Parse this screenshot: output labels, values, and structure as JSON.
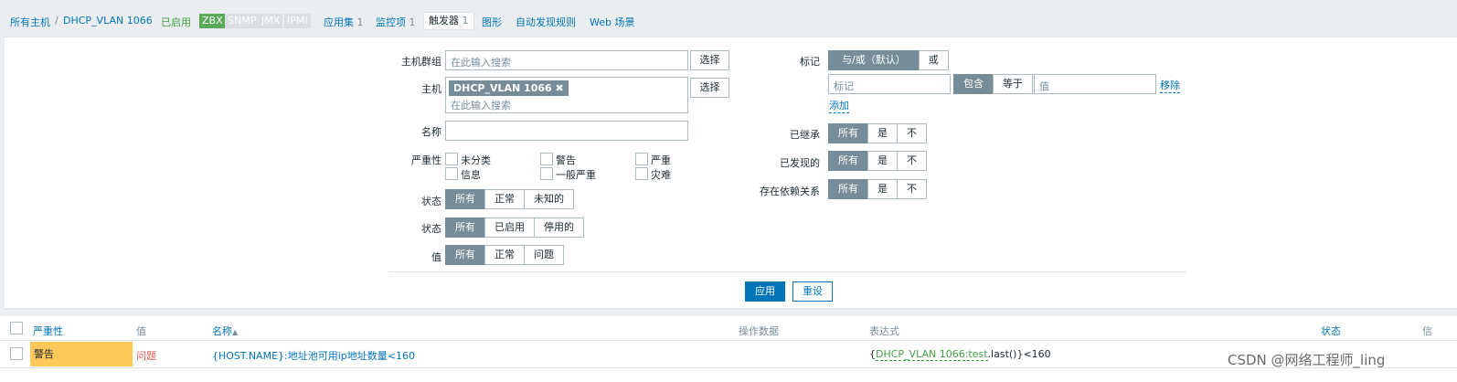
{
  "nav": {
    "breadcrumb_root": "所有主机",
    "breadcrumb_sep": "/",
    "host": "DHCP_VLAN 1066",
    "status": "已启用",
    "tags": [
      "ZBX",
      "SNMP",
      "JMX",
      "IPMI"
    ],
    "applications": "应用集",
    "applications_count": "1",
    "items": "监控项",
    "items_count": "1",
    "triggers": "触发器",
    "triggers_count": "1",
    "graphs": "图形",
    "discovery": "自动发现规则",
    "web": "Web 场景"
  },
  "filter": {
    "host_groups_label": "主机群组",
    "search_placeholder": "在此输入搜索",
    "select_button": "选择",
    "host_label": "主机",
    "host_chip": "DHCP_VLAN 1066",
    "chip_remove": "✖",
    "name_label": "名称",
    "name_value": "",
    "severity_label": "严重性",
    "severities": [
      "未分类",
      "警告",
      "严重",
      "信息",
      "一般严重",
      "灾难"
    ],
    "state_label": "状态",
    "state_options": [
      "所有",
      "正常",
      "未知的"
    ],
    "status_label": "状态",
    "status_options": [
      "所有",
      "已启用",
      "停用的"
    ],
    "value_label": "值",
    "value_options": [
      "所有",
      "正常",
      "问题"
    ],
    "tags_label": "标记",
    "tags_mode_options": [
      "与/或（默认）",
      "或"
    ],
    "tag_placeholder": "标记",
    "tag_op_options": [
      "包含",
      "等于"
    ],
    "value_placeholder": "值",
    "remove_link": "移除",
    "add_link": "添加",
    "inherited_label": "已继承",
    "discovered_label": "已发现的",
    "dependencies_label": "存在依赖关系",
    "yes_no_options": [
      "所有",
      "是",
      "不"
    ],
    "apply_button": "应用",
    "reset_button": "重设"
  },
  "table": {
    "headers": {
      "severity": "严重性",
      "value": "值",
      "name": "名称",
      "sort_icon": "▲",
      "operational_data": "操作数据",
      "expression": "表达式",
      "status": "状态",
      "info": "信"
    },
    "rows": [
      {
        "severity": "警告",
        "value": "问题",
        "name": "{HOST.NAME}:地址池可用ip地址数量<160",
        "expr_open": "{",
        "expr_host_key": "DHCP_VLAN 1066:test",
        "expr_func": ".last()",
        "expr_close": "}<160"
      }
    ]
  },
  "watermark": "CSDN @网络工程师_ling",
  "colors": {
    "accent": "#0275b8",
    "enabled_green": "#429e47",
    "warning": "#ffc859",
    "problem": "#e45959",
    "toggle_on": "#768d99"
  }
}
